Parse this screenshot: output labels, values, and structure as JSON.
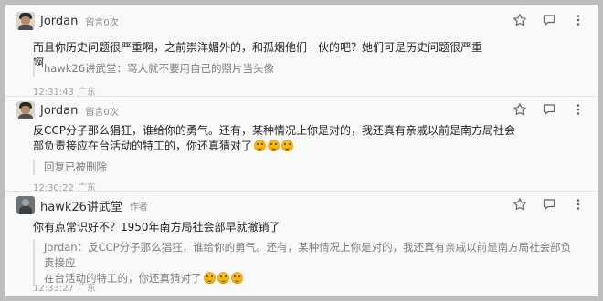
{
  "comments": [
    {
      "username": "Jordan",
      "tag": "留言0次",
      "text": "而且你历史问题很严重啊，之前崇洋媚外的，和孤烟他们一伙的吧？她们可是历史问题很严重啊",
      "quote_name": "hawk26讲武堂：",
      "quote_text": "骂人就不要用自己的照片当头像",
      "time": "12:31:43",
      "location": "广东",
      "avatar": "jordan-photo"
    },
    {
      "username": "Jordan",
      "tag": "留言0次",
      "text_line1": "反CCP分子那么猖狂，谁给你的勇气。还有，某种情况上你是对的，我还真有亲戚以前是南方局社会",
      "text_line2": "部负责接应在台活动的特工的，你还真猜对了",
      "quote_text": "回复已被删除",
      "time": "12:30:22",
      "location": "广东",
      "avatar": "jordan-photo"
    },
    {
      "username": "hawk26讲武堂",
      "tag": "作者",
      "text": "你有点常识好不？1950年南方局社会部早就撤销了",
      "quote_name": "Jordan：",
      "quote_line1": "反CCP分子那么猖狂，谁给你的勇气。还有，某种情况上你是对的，我还真有亲戚以前是南方局社会部负责接应",
      "quote_line2": "在台活动的特工的，你还真猜对了",
      "time": "12:33:27",
      "location": "广东",
      "avatar": "author-photo"
    }
  ],
  "icons": {
    "favorite": "star-icon",
    "reply": "reply-icon",
    "more": "more-icon",
    "emoji": "thinking-emoji"
  },
  "colors": {
    "background": "#f9f9f9",
    "text": "#222222",
    "muted": "#7d7d7d",
    "emoji": "#f2b51c"
  }
}
